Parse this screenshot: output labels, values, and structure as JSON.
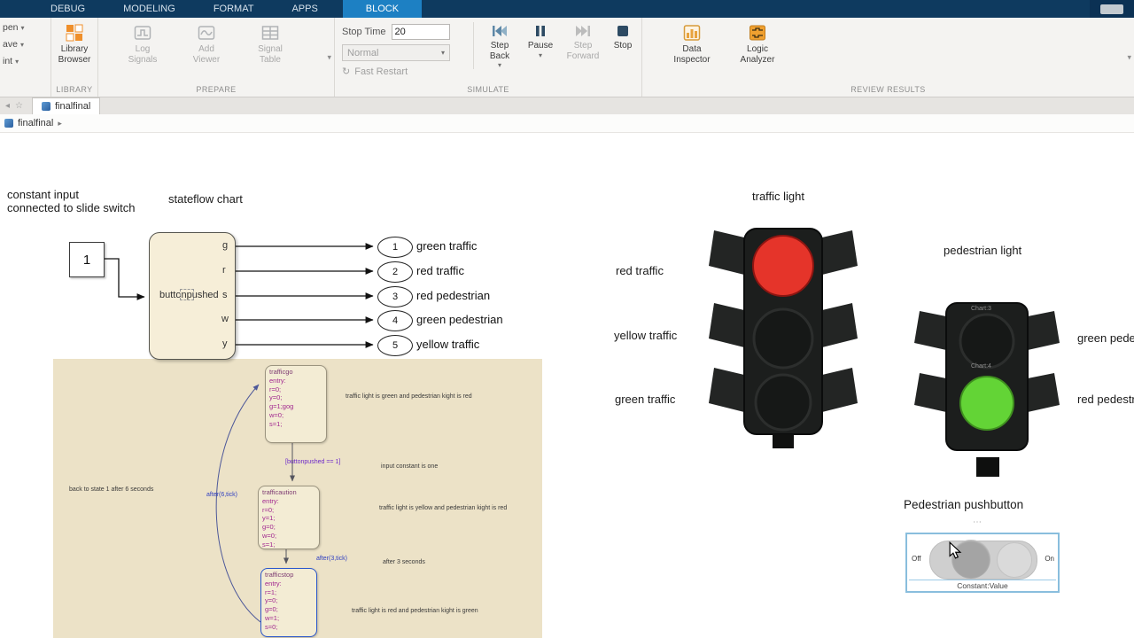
{
  "ui": {
    "caret": "▾",
    "chevron": "▸",
    "ellipsis": "⋯",
    "star": "☆",
    "back": "◂",
    "restart": "↻"
  },
  "ribbon": {
    "tabs": [
      "DEBUG",
      "MODELING",
      "FORMAT",
      "APPS",
      "BLOCK"
    ]
  },
  "quick": {
    "open": "pen",
    "save": "ave",
    "print": "int"
  },
  "toolbar": {
    "library": {
      "section": "LIBRARY",
      "browser": "Library\nBrowser"
    },
    "prepare": {
      "section": "PREPARE",
      "log": "Log\nSignals",
      "viewer": "Add\nViewer",
      "table": "Signal\nTable"
    },
    "simulate": {
      "section": "SIMULATE",
      "stop_time_label": "Stop Time",
      "stop_time": "20",
      "mode": "Normal",
      "fast_restart": "Fast Restart",
      "step_back": "Step\nBack",
      "pause": "Pause",
      "step_forward": "Step\nForward",
      "stop": "Stop"
    },
    "review": {
      "section": "REVIEW RESULTS",
      "inspector": "Data\nInspector",
      "analyzer": "Logic\nAnalyzer"
    }
  },
  "doc": {
    "tab": "finalfinal",
    "breadcrumb": "finalfinal"
  },
  "diagram": {
    "note_constant": "constant input\nconnected to slide switch",
    "label_stateflow": "stateflow chart",
    "constant_value": "1",
    "chart_input": "buttonpushed",
    "ports": [
      "g",
      "r",
      "s",
      "w",
      "y"
    ],
    "outputs": [
      {
        "n": "1",
        "label": "green traffic"
      },
      {
        "n": "2",
        "label": "red traffic"
      },
      {
        "n": "3",
        "label": "red pedestrian"
      },
      {
        "n": "4",
        "label": "green pedestrian"
      },
      {
        "n": "5",
        "label": "yellow traffic"
      }
    ]
  },
  "chart": {
    "states": [
      {
        "name": "trafficgo",
        "code": "entry:\nr=0;\ny=0;\ng=1;gog\nw=0;\ns=1;"
      },
      {
        "name": "trafficaution",
        "code": "entry:\nr=0;\ny=1;\ng=0;\nw=0;\ns=1;"
      },
      {
        "name": "trafficstop",
        "code": "entry:\nr=1;\ny=0;\ng=0;\nw=1;\ns=0;"
      }
    ],
    "t_condition": "[buttonpushed == 1]",
    "t_after3": "after(3,tick)",
    "t_after6": "after(6,tick)",
    "notes": [
      "traffic light is green and pedestrian kight is red",
      "input constant is one",
      "traffic light is yellow and pedestrian kight is red",
      "after 3 seconds",
      "traffic light is red and pedestrian kight is green",
      "back to state 1 after 6 seconds"
    ]
  },
  "traffic_light": {
    "title": "traffic light",
    "labels": [
      "red traffic",
      "yellow traffic",
      "green traffic"
    ],
    "red_on": "#e5342a",
    "lamp_off": "#161817"
  },
  "ped_light": {
    "title": "pedestrian light",
    "labels": [
      "green pedestrian",
      "red pedestrian"
    ],
    "green_on": "#63d436",
    "lamp_off": "#161817",
    "faint": [
      "Chart:3",
      "Chart:4"
    ]
  },
  "switch": {
    "title": "Pedestrian pushbutton",
    "off": "Off",
    "on": "On",
    "caption": "Constant:Value"
  }
}
